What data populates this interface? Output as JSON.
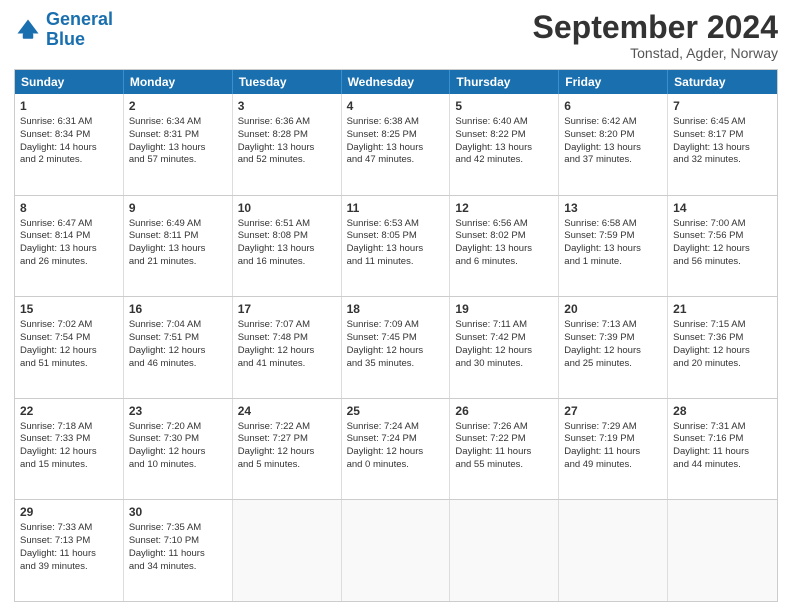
{
  "logo": {
    "line1": "General",
    "line2": "Blue"
  },
  "title": "September 2024",
  "subtitle": "Tonstad, Agder, Norway",
  "header_days": [
    "Sunday",
    "Monday",
    "Tuesday",
    "Wednesday",
    "Thursday",
    "Friday",
    "Saturday"
  ],
  "rows": [
    [
      {
        "day": "1",
        "lines": [
          "Sunrise: 6:31 AM",
          "Sunset: 8:34 PM",
          "Daylight: 14 hours",
          "and 2 minutes."
        ]
      },
      {
        "day": "2",
        "lines": [
          "Sunrise: 6:34 AM",
          "Sunset: 8:31 PM",
          "Daylight: 13 hours",
          "and 57 minutes."
        ]
      },
      {
        "day": "3",
        "lines": [
          "Sunrise: 6:36 AM",
          "Sunset: 8:28 PM",
          "Daylight: 13 hours",
          "and 52 minutes."
        ]
      },
      {
        "day": "4",
        "lines": [
          "Sunrise: 6:38 AM",
          "Sunset: 8:25 PM",
          "Daylight: 13 hours",
          "and 47 minutes."
        ]
      },
      {
        "day": "5",
        "lines": [
          "Sunrise: 6:40 AM",
          "Sunset: 8:22 PM",
          "Daylight: 13 hours",
          "and 42 minutes."
        ]
      },
      {
        "day": "6",
        "lines": [
          "Sunrise: 6:42 AM",
          "Sunset: 8:20 PM",
          "Daylight: 13 hours",
          "and 37 minutes."
        ]
      },
      {
        "day": "7",
        "lines": [
          "Sunrise: 6:45 AM",
          "Sunset: 8:17 PM",
          "Daylight: 13 hours",
          "and 32 minutes."
        ]
      }
    ],
    [
      {
        "day": "8",
        "lines": [
          "Sunrise: 6:47 AM",
          "Sunset: 8:14 PM",
          "Daylight: 13 hours",
          "and 26 minutes."
        ]
      },
      {
        "day": "9",
        "lines": [
          "Sunrise: 6:49 AM",
          "Sunset: 8:11 PM",
          "Daylight: 13 hours",
          "and 21 minutes."
        ]
      },
      {
        "day": "10",
        "lines": [
          "Sunrise: 6:51 AM",
          "Sunset: 8:08 PM",
          "Daylight: 13 hours",
          "and 16 minutes."
        ]
      },
      {
        "day": "11",
        "lines": [
          "Sunrise: 6:53 AM",
          "Sunset: 8:05 PM",
          "Daylight: 13 hours",
          "and 11 minutes."
        ]
      },
      {
        "day": "12",
        "lines": [
          "Sunrise: 6:56 AM",
          "Sunset: 8:02 PM",
          "Daylight: 13 hours",
          "and 6 minutes."
        ]
      },
      {
        "day": "13",
        "lines": [
          "Sunrise: 6:58 AM",
          "Sunset: 7:59 PM",
          "Daylight: 13 hours",
          "and 1 minute."
        ]
      },
      {
        "day": "14",
        "lines": [
          "Sunrise: 7:00 AM",
          "Sunset: 7:56 PM",
          "Daylight: 12 hours",
          "and 56 minutes."
        ]
      }
    ],
    [
      {
        "day": "15",
        "lines": [
          "Sunrise: 7:02 AM",
          "Sunset: 7:54 PM",
          "Daylight: 12 hours",
          "and 51 minutes."
        ]
      },
      {
        "day": "16",
        "lines": [
          "Sunrise: 7:04 AM",
          "Sunset: 7:51 PM",
          "Daylight: 12 hours",
          "and 46 minutes."
        ]
      },
      {
        "day": "17",
        "lines": [
          "Sunrise: 7:07 AM",
          "Sunset: 7:48 PM",
          "Daylight: 12 hours",
          "and 41 minutes."
        ]
      },
      {
        "day": "18",
        "lines": [
          "Sunrise: 7:09 AM",
          "Sunset: 7:45 PM",
          "Daylight: 12 hours",
          "and 35 minutes."
        ]
      },
      {
        "day": "19",
        "lines": [
          "Sunrise: 7:11 AM",
          "Sunset: 7:42 PM",
          "Daylight: 12 hours",
          "and 30 minutes."
        ]
      },
      {
        "day": "20",
        "lines": [
          "Sunrise: 7:13 AM",
          "Sunset: 7:39 PM",
          "Daylight: 12 hours",
          "and 25 minutes."
        ]
      },
      {
        "day": "21",
        "lines": [
          "Sunrise: 7:15 AM",
          "Sunset: 7:36 PM",
          "Daylight: 12 hours",
          "and 20 minutes."
        ]
      }
    ],
    [
      {
        "day": "22",
        "lines": [
          "Sunrise: 7:18 AM",
          "Sunset: 7:33 PM",
          "Daylight: 12 hours",
          "and 15 minutes."
        ]
      },
      {
        "day": "23",
        "lines": [
          "Sunrise: 7:20 AM",
          "Sunset: 7:30 PM",
          "Daylight: 12 hours",
          "and 10 minutes."
        ]
      },
      {
        "day": "24",
        "lines": [
          "Sunrise: 7:22 AM",
          "Sunset: 7:27 PM",
          "Daylight: 12 hours",
          "and 5 minutes."
        ]
      },
      {
        "day": "25",
        "lines": [
          "Sunrise: 7:24 AM",
          "Sunset: 7:24 PM",
          "Daylight: 12 hours",
          "and 0 minutes."
        ]
      },
      {
        "day": "26",
        "lines": [
          "Sunrise: 7:26 AM",
          "Sunset: 7:22 PM",
          "Daylight: 11 hours",
          "and 55 minutes."
        ]
      },
      {
        "day": "27",
        "lines": [
          "Sunrise: 7:29 AM",
          "Sunset: 7:19 PM",
          "Daylight: 11 hours",
          "and 49 minutes."
        ]
      },
      {
        "day": "28",
        "lines": [
          "Sunrise: 7:31 AM",
          "Sunset: 7:16 PM",
          "Daylight: 11 hours",
          "and 44 minutes."
        ]
      }
    ],
    [
      {
        "day": "29",
        "lines": [
          "Sunrise: 7:33 AM",
          "Sunset: 7:13 PM",
          "Daylight: 11 hours",
          "and 39 minutes."
        ]
      },
      {
        "day": "30",
        "lines": [
          "Sunrise: 7:35 AM",
          "Sunset: 7:10 PM",
          "Daylight: 11 hours",
          "and 34 minutes."
        ]
      },
      {
        "day": "",
        "lines": []
      },
      {
        "day": "",
        "lines": []
      },
      {
        "day": "",
        "lines": []
      },
      {
        "day": "",
        "lines": []
      },
      {
        "day": "",
        "lines": []
      }
    ]
  ]
}
